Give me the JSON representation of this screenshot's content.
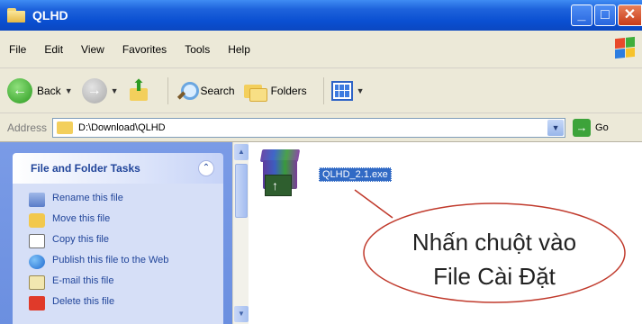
{
  "window": {
    "title": "QLHD",
    "controls": {
      "minimize": "_",
      "maximize": "□",
      "close": "✕"
    }
  },
  "menu": {
    "items": [
      "File",
      "Edit",
      "View",
      "Favorites",
      "Tools",
      "Help"
    ]
  },
  "toolbar": {
    "back_label": "Back",
    "search_label": "Search",
    "folders_label": "Folders"
  },
  "address": {
    "label": "Address",
    "value": "D:\\Download\\QLHD",
    "go_label": "Go"
  },
  "task_pane": {
    "title": "File and Folder Tasks",
    "collapse_glyph": "⌃",
    "items": [
      {
        "label": "Rename this file",
        "icon": "rename-icon"
      },
      {
        "label": "Move this file",
        "icon": "move-icon"
      },
      {
        "label": "Copy this file",
        "icon": "copy-icon"
      },
      {
        "label": "Publish this file to the Web",
        "icon": "publish-icon"
      },
      {
        "label": "E-mail this file",
        "icon": "email-icon"
      },
      {
        "label": "Delete this file",
        "icon": "delete-icon"
      }
    ]
  },
  "content": {
    "file_name": "QLHD_2.1.exe",
    "callout_line1": "Nhấn chuột vào",
    "callout_line2": "File Cài Đặt"
  },
  "colors": {
    "titlebar": "#0a4fd1",
    "selection": "#316ac5",
    "taskpane": "#6b8fe0",
    "callout_outline": "#c0392b"
  }
}
